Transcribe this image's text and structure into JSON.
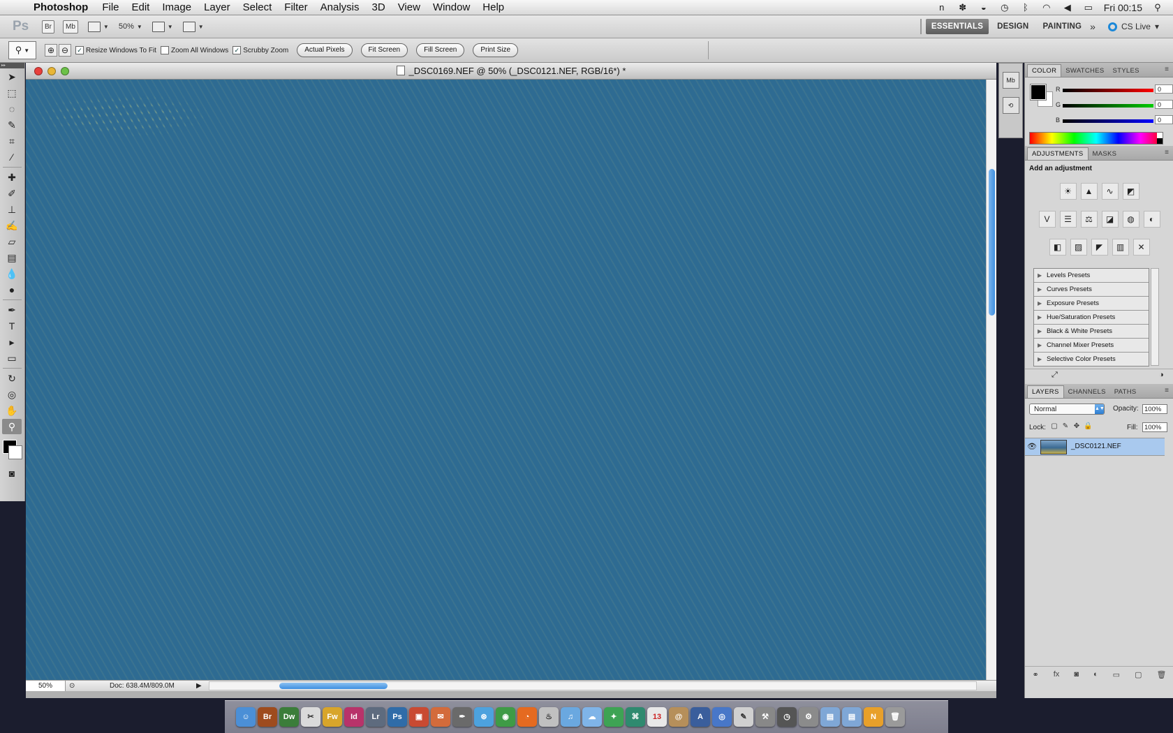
{
  "menubar": {
    "app_name": "Photoshop",
    "items": [
      "File",
      "Edit",
      "Image",
      "Layer",
      "Select",
      "Filter",
      "Analysis",
      "3D",
      "View",
      "Window",
      "Help"
    ],
    "clock": "Fri 00:15"
  },
  "appbar": {
    "logo": "Ps",
    "bridge_label": "Br",
    "minibridge_label": "Mb",
    "zoom_value": "50%",
    "workspaces": [
      "ESSENTIALS",
      "DESIGN",
      "PAINTING"
    ],
    "active_workspace": "ESSENTIALS",
    "more_label": "»",
    "cs_live": "CS Live"
  },
  "options": {
    "resize_windows_label": "Resize Windows To Fit",
    "zoom_all_label": "Zoom All Windows",
    "scrubby_zoom_label": "Scrubby Zoom",
    "buttons": [
      "Actual Pixels",
      "Fit Screen",
      "Fill Screen",
      "Print Size"
    ]
  },
  "document": {
    "title": "_DSC0169.NEF @ 50% (_DSC0121.NEF, RGB/16*) *",
    "zoom": "50%",
    "doc_info": "Doc: 638.4M/809.0M"
  },
  "colors": {
    "canvas_blue": "#2e6b92",
    "pattern_yellow": "#dede80",
    "selected_layer": "#a9c9ee"
  },
  "panels": {
    "color_tabs": [
      "COLOR",
      "SWATCHES",
      "STYLES"
    ],
    "rgb": [
      {
        "label": "R",
        "value": "0"
      },
      {
        "label": "G",
        "value": "0"
      },
      {
        "label": "B",
        "value": "0"
      }
    ],
    "adjust_tabs": [
      "ADJUSTMENTS",
      "MASKS"
    ],
    "add_adjustment": "Add an adjustment",
    "presets": [
      "Levels Presets",
      "Curves Presets",
      "Exposure Presets",
      "Hue/Saturation Presets",
      "Black & White Presets",
      "Channel Mixer Presets",
      "Selective Color Presets"
    ],
    "layers_tabs": [
      "LAYERS",
      "CHANNELS",
      "PATHS"
    ],
    "blend_mode": "Normal",
    "opacity_label": "Opacity:",
    "opacity_value": "100%",
    "lock_label": "Lock:",
    "fill_label": "Fill:",
    "fill_value": "100%",
    "layer_name": "_DSC0121.NEF"
  },
  "dock": {
    "apps": [
      "Br",
      "Dw",
      "Fw",
      "Id",
      "Lr",
      "Ps",
      "13"
    ]
  }
}
